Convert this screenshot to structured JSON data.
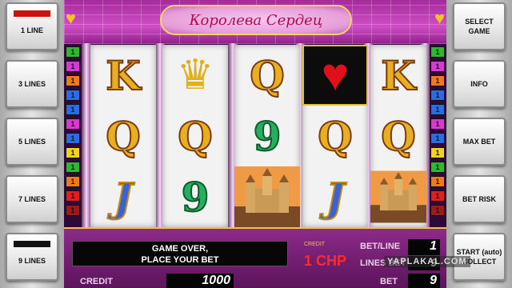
{
  "game": {
    "title": "Королева Сердец"
  },
  "left_buttons": [
    {
      "label": "1 LINE"
    },
    {
      "label": "3 LINES"
    },
    {
      "label": "5 LINES"
    },
    {
      "label": "7 LINES"
    },
    {
      "label": "9 LINES"
    }
  ],
  "right_buttons": [
    {
      "label": "SELECT GAME"
    },
    {
      "label": "INFO"
    },
    {
      "label": "MAX BET"
    },
    {
      "label": "BET RISK"
    },
    {
      "label": "START (auto) COLLECT"
    }
  ],
  "line_numbers": {
    "left": [
      "1",
      "1",
      "1",
      "1",
      "1",
      "1",
      "1",
      "1",
      "1",
      "1",
      "1",
      "1"
    ],
    "right": [
      "1",
      "1",
      "1",
      "1",
      "1",
      "1",
      "1",
      "1",
      "1",
      "1",
      "1",
      "1"
    ]
  },
  "reels": [
    [
      "K",
      "Q",
      "J"
    ],
    [
      "crown",
      "Q",
      "9"
    ],
    [
      "Q",
      "9",
      "castle"
    ],
    [
      "heart",
      "Q",
      "J"
    ],
    [
      "K",
      "Q",
      "castle"
    ]
  ],
  "status": {
    "message_line1": "GAME OVER,",
    "message_line2": "PLACE YOUR BET",
    "credit_label_small": "CREDIT",
    "credit_value": "1 CHP",
    "bet_line_label": "BET/LINE",
    "bet_line_value": "1",
    "lines_bet_label": "LINES BET",
    "lines_bet_value": "9",
    "credit_label": "CREDIT",
    "credit_amount": "1000",
    "bet_label": "BET",
    "bet_value": "9"
  },
  "watermark": "YAPLAKAL.COM",
  "colors": {
    "line_red": "#e21f1f",
    "line_magenta": "#d63ad0",
    "line_blue": "#2b6de0",
    "line_green": "#2fb82f",
    "line_yellow": "#f4d21a",
    "line_orange": "#f07a1a",
    "line_darkred": "#9c1a1a"
  }
}
